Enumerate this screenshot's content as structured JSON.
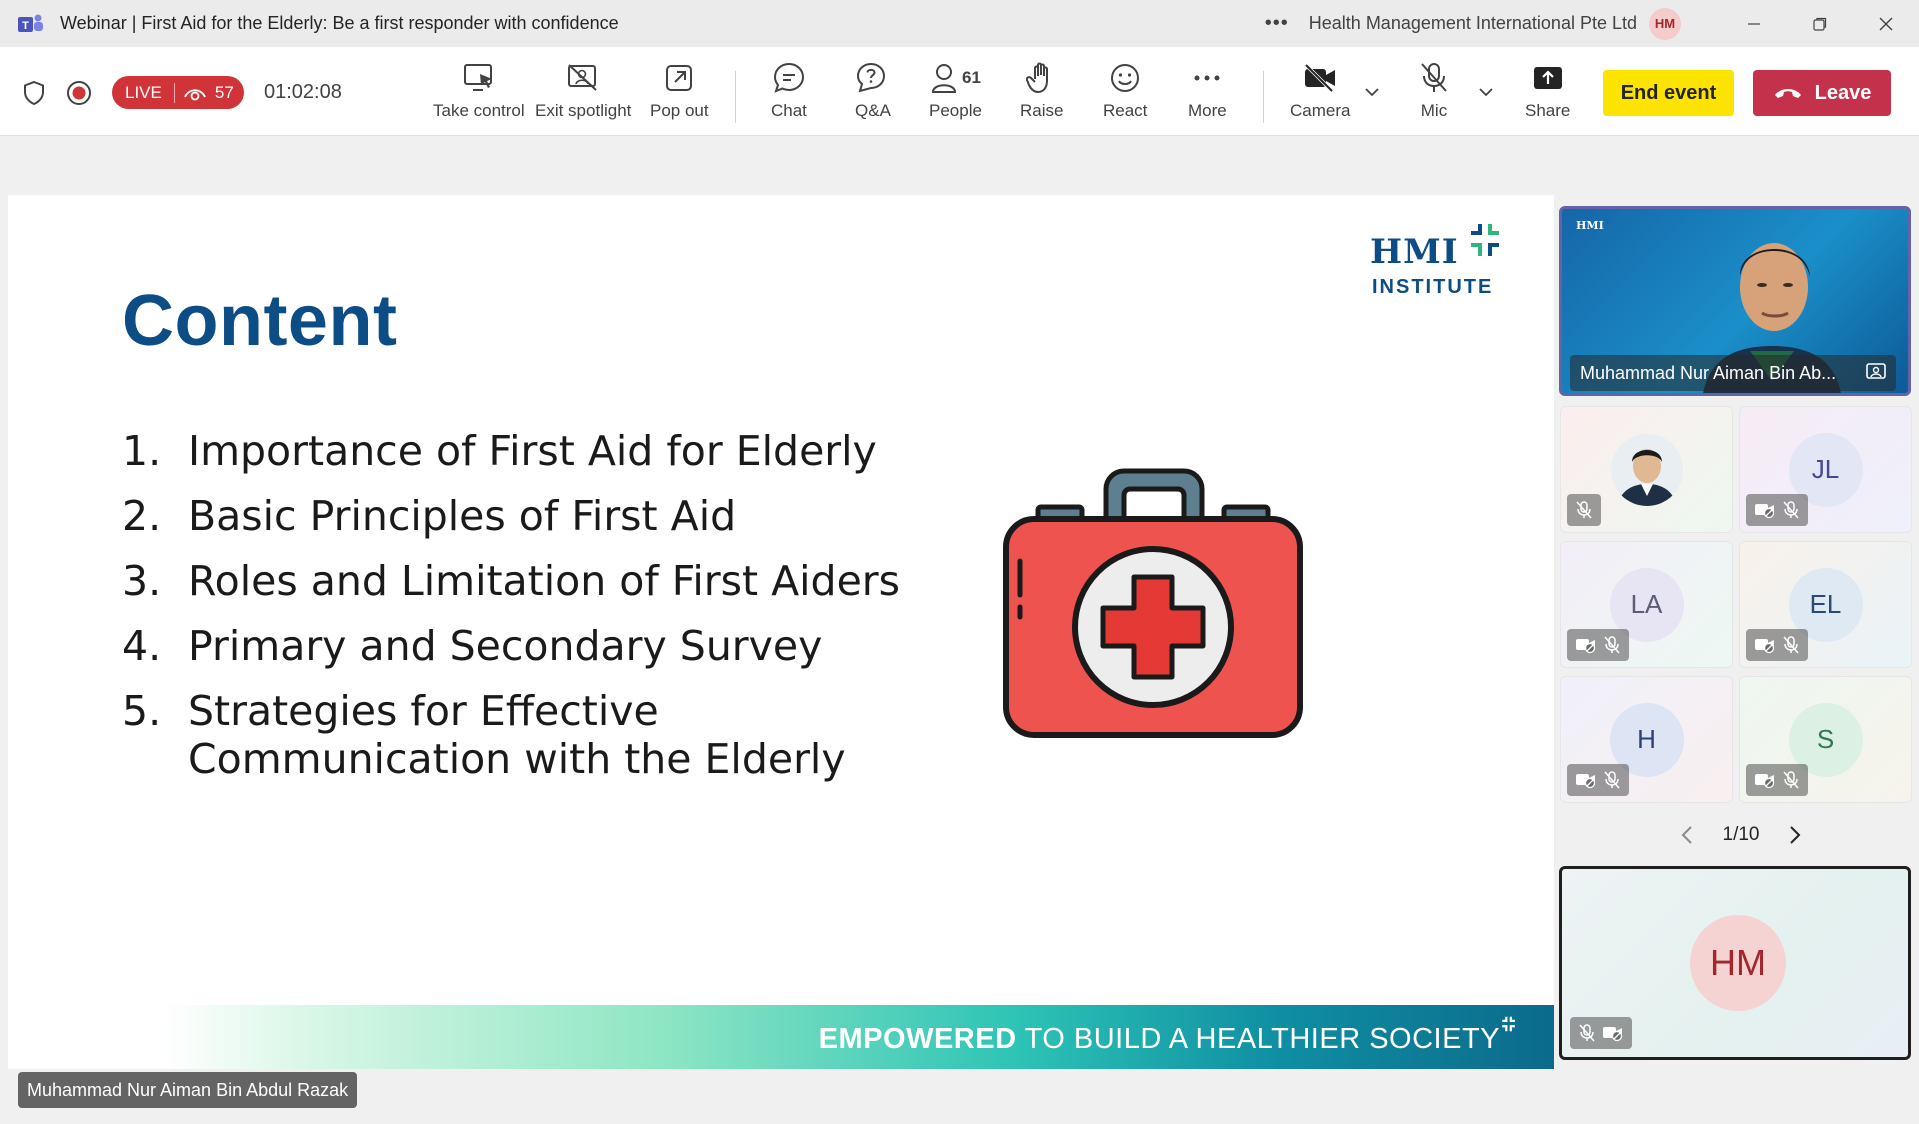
{
  "window": {
    "title": "Webinar | First Aid for the Elderly: Be a first responder with confidence",
    "org_name": "Health Management International Pte Ltd",
    "user_initials": "HM"
  },
  "toolbar": {
    "live_label": "LIVE",
    "viewer_count": "57",
    "timer": "01:02:08",
    "take_control": "Take control",
    "exit_spotlight": "Exit spotlight",
    "pop_out": "Pop out",
    "chat": "Chat",
    "qa": "Q&A",
    "people": "People",
    "people_count": "61",
    "raise": "Raise",
    "react": "React",
    "more": "More",
    "camera": "Camera",
    "mic": "Mic",
    "share": "Share",
    "end_event": "End event",
    "leave": "Leave"
  },
  "slide": {
    "title": "Content",
    "logo_word": "HMI",
    "logo_sub": "INSTITUTE",
    "items": [
      {
        "num": "1.",
        "text": "Importance of First Aid for Elderly"
      },
      {
        "num": "2.",
        "text": "Basic Principles of First Aid"
      },
      {
        "num": "3.",
        "text": "Roles and Limitation of First Aiders"
      },
      {
        "num": "4.",
        "text": "Primary and Secondary Survey"
      },
      {
        "num": "5.",
        "text": "Strategies for Effective Communication with the Elderly"
      }
    ],
    "banner_bold": "EMPOWERED",
    "banner_rest": "TO BUILD A HEALTHIER SOCIETY"
  },
  "presenter_tag": "Muhammad Nur Aiman Bin Abdul Razak",
  "participants": {
    "spotlight_name": "Muhammad Nur Aiman Bin Ab...",
    "spotlight_logo": "HMI",
    "tiles": [
      {
        "initials": ""
      },
      {
        "initials": "JL"
      },
      {
        "initials": "LA"
      },
      {
        "initials": "EL"
      },
      {
        "initials": "H"
      },
      {
        "initials": "S"
      }
    ],
    "page": "1/10",
    "self_initials": "HM"
  },
  "colors": {
    "brand_purple": "#6264a7",
    "live_red": "#d13438",
    "end_event_yellow": "#fde300",
    "leave_red": "#c4314b",
    "slide_title_blue": "#0d4d86"
  }
}
